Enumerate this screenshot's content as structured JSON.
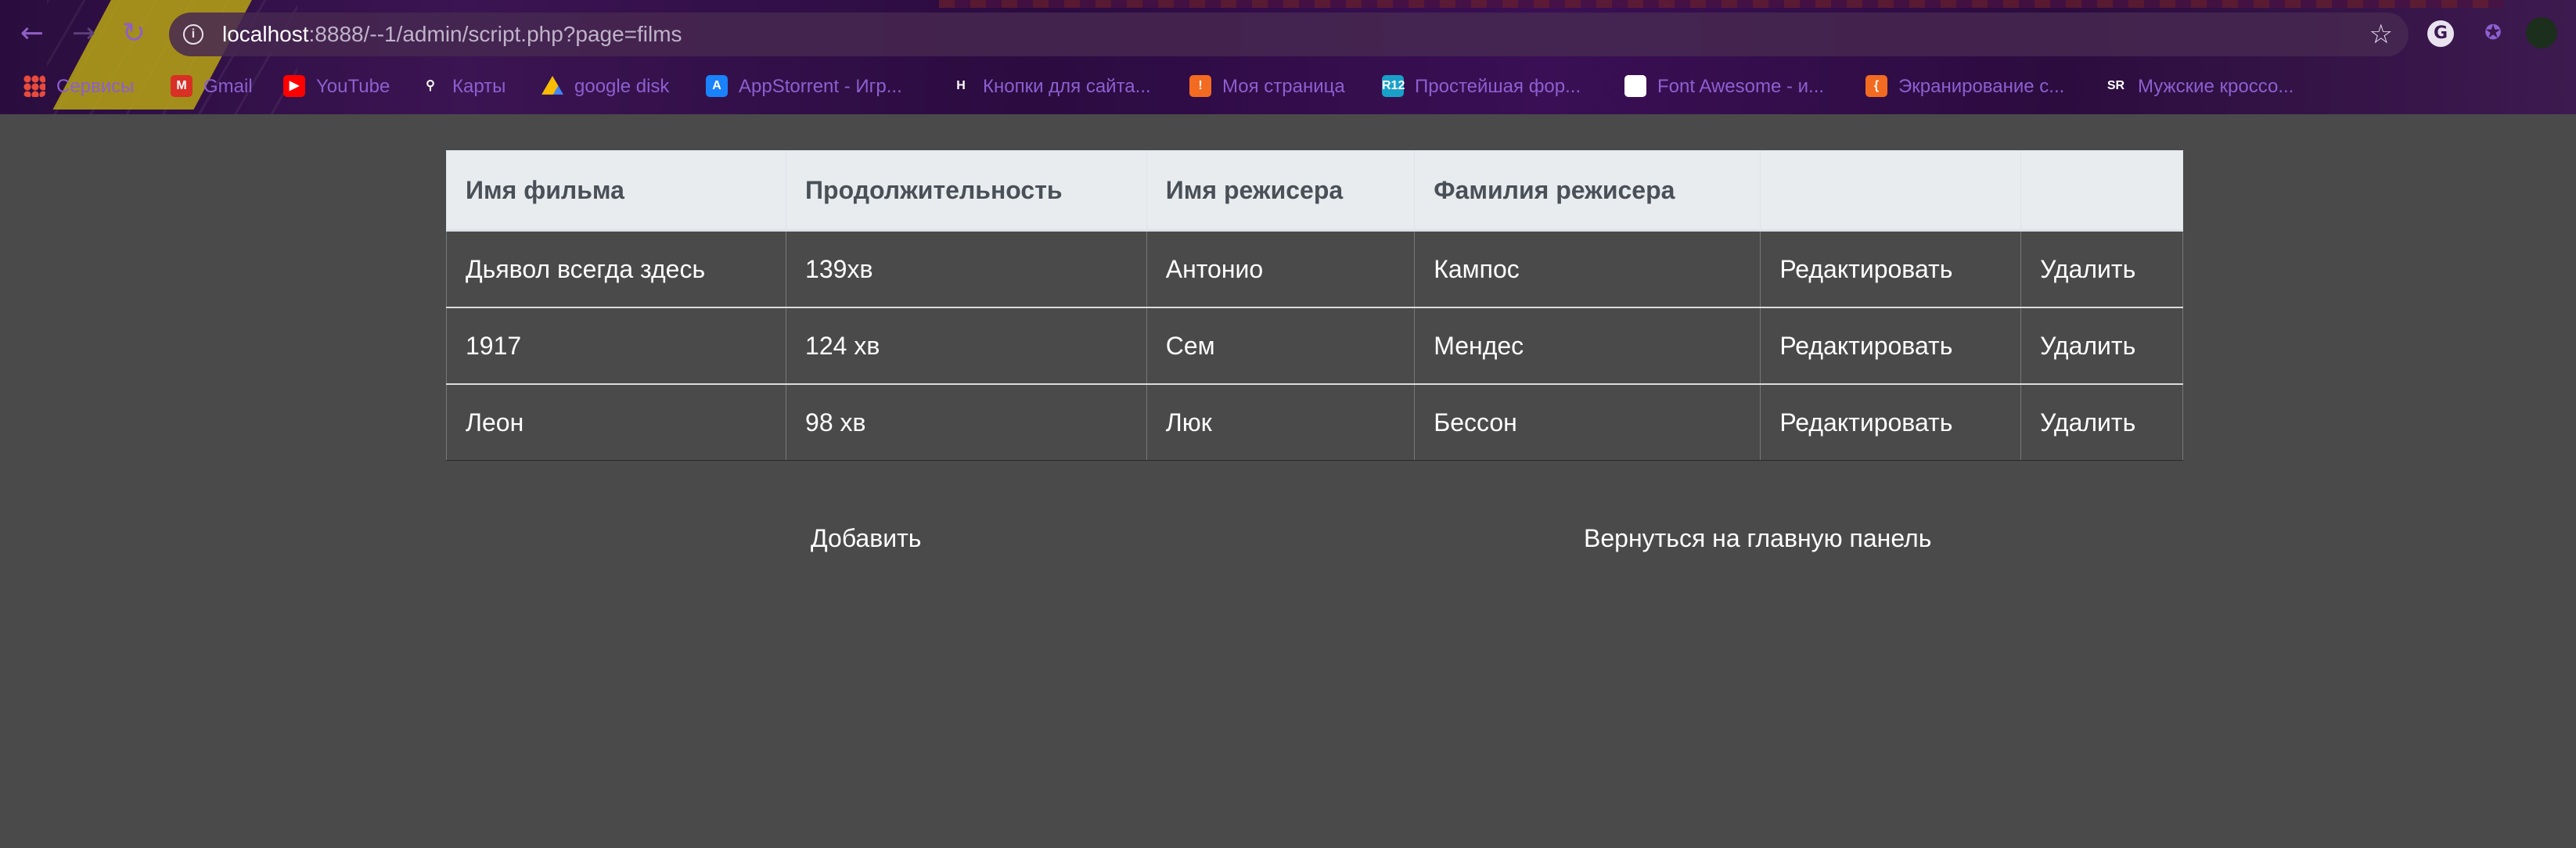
{
  "browser": {
    "url_host": "localhost",
    "url_rest": ":8888/--1/admin/script.php?page=films",
    "bookmarks": [
      {
        "label": "Сервисы",
        "icon": "apps-grid-icon"
      },
      {
        "label": "Gmail",
        "icon": "gmail-icon"
      },
      {
        "label": "YouTube",
        "icon": "youtube-icon"
      },
      {
        "label": "Карты",
        "icon": "maps-pin-icon"
      },
      {
        "label": "google disk",
        "icon": "google-drive-icon"
      },
      {
        "label": "AppStorrent - Игр...",
        "icon": "appstore-icon"
      },
      {
        "label": "Кнопки для сайта...",
        "icon": "buttons-site-icon"
      },
      {
        "label": "Моя страница",
        "icon": "orange-hex-icon"
      },
      {
        "label": "Простейшая фор...",
        "icon": "r12-icon"
      },
      {
        "label": "Font Awesome - и...",
        "icon": "flag-icon"
      },
      {
        "label": "Экранирование с...",
        "icon": "orange-hex-icon"
      },
      {
        "label": "Мужские кроссо...",
        "icon": "snr-icon"
      }
    ]
  },
  "table": {
    "headers": [
      "Имя фильма",
      "Продолжительность",
      "Имя режисера",
      "Фамилия режисера",
      "",
      ""
    ],
    "rows": [
      {
        "film": "Дьявол всегда здесь",
        "duration": "139хв",
        "first_name": "Антонио",
        "last_name": "Кампос",
        "edit": "Редактировать",
        "delete": "Удалить"
      },
      {
        "film": "1917",
        "duration": "124 хв",
        "first_name": "Сем",
        "last_name": "Мендес",
        "edit": "Редактировать",
        "delete": "Удалить"
      },
      {
        "film": "Леон",
        "duration": "98 хв",
        "first_name": "Люк",
        "last_name": "Бессон",
        "edit": "Редактировать",
        "delete": "Удалить"
      }
    ]
  },
  "actions": {
    "add": "Добавить",
    "back": "Вернуться на главную панель"
  },
  "colors": {
    "page_bg": "#4a4a4a",
    "header_bg": "#e9ecef",
    "header_text": "#495057",
    "bookmark_text": "#8d5fd0"
  }
}
